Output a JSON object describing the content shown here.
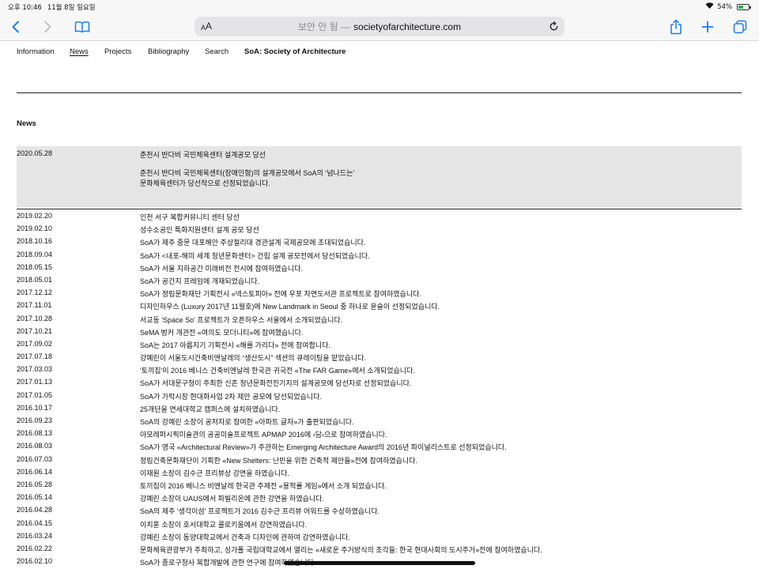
{
  "status_bar": {
    "time": "오후 10:46",
    "date": "11월 8일 일요일",
    "battery": "54%",
    "battery_level": 0.54
  },
  "browser": {
    "aa_small": "A",
    "aa_big": "A",
    "secure_label": "보안 안 됨 —",
    "domain": "societyofarchitecture.com",
    "icons": [
      "back-icon",
      "forward-icon",
      "bookmarks-icon",
      "reload-icon",
      "share-icon",
      "new-tab-icon",
      "tabs-icon"
    ]
  },
  "nav": {
    "items": [
      "Information",
      "News",
      "Projects",
      "Bibliography",
      "Search"
    ],
    "active": "News",
    "brand": "SoA: Society of Architecture"
  },
  "section_title": "News",
  "featured": {
    "date": "2020.05.28",
    "title": "춘천시 반다비 국민체육센터 설계공모 당선",
    "description_line1": "춘천시 반다비 국민체육센터(장애인형)의 설계공모에서 SoA의 ‘넘나드는’",
    "description_line2": "문화체육센터가 당선작으로 선정되었습니다."
  },
  "news": [
    {
      "date": "2019.02.20",
      "title": "인천 서구 복합커뮤니티 센터 당선"
    },
    {
      "date": "2019.02.10",
      "title": "성수소공인 특화지원센터 설계 공모 당선"
    },
    {
      "date": "2018.10.16",
      "title": "SoA가 제주 중문 대포해안 주상절리대 경관설계 국제공모에 초대되었습니다."
    },
    {
      "date": "2018.09.04",
      "title": "SoA가 <내포-해미 세계 청년문화센터> 건립 설계 공모전에서 당선되었습니다."
    },
    {
      "date": "2018.05.15",
      "title": "SoA가 서울 지하공간 미래비전 전시에 참여하였습니다."
    },
    {
      "date": "2018.05.01",
      "title": "SoA가 공간지 프레임에 개재되었습니다."
    },
    {
      "date": "2017.12.12",
      "title": "SoA가 정림문화재단 기획전시 «넥스토피아» 전에 우포 자연도서관 프로젝트로 참여하였습니다."
    },
    {
      "date": "2017.11.01",
      "title": "디자인하우스 (Luxury 2017년 11월호)에 New Landmark in Seoul 중 하나로 윤슬이 선정되었습니다."
    },
    {
      "date": "2017.10.28",
      "title": "서교동 'Space So' 프로젝트가 오픈하우스 서울에서 소개되었습니다."
    },
    {
      "date": "2017.10.21",
      "title": "SeMA 벙커 개관전 «여의도 모더니티»에 참여했습니다."
    },
    {
      "date": "2017.09.02",
      "title": "SoA는 2017 아름지기 기획전시 «해를 가리다» 전에 참여합니다."
    },
    {
      "date": "2017.07.18",
      "title": "강예린이 서울도시건축비엔날레의 “생산도시” 섹션의 큐레이팅을 맡았습니다."
    },
    {
      "date": "2017.03.03",
      "title": "'토끼집'이 2016 베니스 건축비엔날레 한국관 귀국전 «The FAR Game»에서 소개되었습니다."
    },
    {
      "date": "2017.01.13",
      "title": "SoA가 서대문구청이 주최한 신촌 청년문화전진기지의 설계공모에 당선자로 선정되었습니다."
    },
    {
      "date": "2017.01.05",
      "title": "SoA가 가락시장 현대화사업 2차 제안 공모에 당선되었습니다."
    },
    {
      "date": "2016.10.17",
      "title": "25개단을 연세대학교 캠퍼스에 설치하였습니다."
    },
    {
      "date": "2016.09.23",
      "title": "SoA의 강예린 소장이 공저자로 참여한 «아파트 글자»가 출판되었습니다."
    },
    {
      "date": "2016.08.13",
      "title": "아모레퍼시픽미술관의 공공미술프로젝트 APMAP 2016에 ‹담›으로 참여하였습니다."
    },
    {
      "date": "2016.08.03",
      "title": "SoA가 영국 «Architectural Review»가 주관하는 Emerging Architecture Award의 2016년 파이널리스트로 선정되었습니다."
    },
    {
      "date": "2016.07.03",
      "title": "정림건축문화재단이 기획한 «New Shelters: 난민을 위한 건축적 제안들»전에 참여하였습니다."
    },
    {
      "date": "2016.06.14",
      "title": "이재원 소장이 김수근 프리뷰상 강연을 하였습니다."
    },
    {
      "date": "2016.05.28",
      "title": "토끼집이 2016 베니스 비엔날레 한국관 주제전 «용적률 게임»에서 소개 되었습니다."
    },
    {
      "date": "2016.05.14",
      "title": "강예린 소장이 UAUS에서 파빌리온에 관한 강연을 하였습니다."
    },
    {
      "date": "2016.04.28",
      "title": "SoA의 제주 '생각이섬' 프로젝트가 2016 김수근 프리뷰 어워드를 수상하였습니다."
    },
    {
      "date": "2016.04.15",
      "title": "이치훈 소장이 호서대학교 콜로키움에서 강연하였습니다."
    },
    {
      "date": "2016.03.24",
      "title": "강예린 소장이 동양대학교에서 건축과 디자인에 관하여 강연하였습니다."
    },
    {
      "date": "2016.02.22",
      "title": "문화체육관광부가 주최하고, 싱가폴 국립대학교에서 열리는 «새로운 주거방식의 조각들: 한국 현대사회의 도시주거»전에 참여하였습니다."
    },
    {
      "date": "2016.02.10",
      "title": "SoA가 종로구청사 복합개발에 관한 연구에 참여하였습니다."
    }
  ]
}
